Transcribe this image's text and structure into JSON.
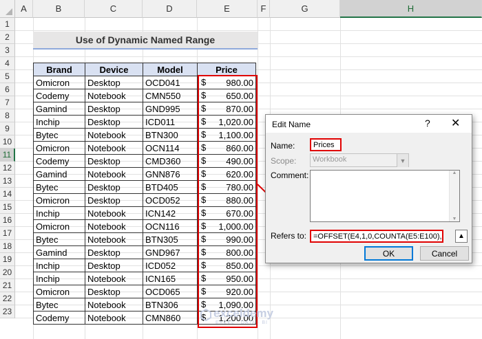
{
  "sheet": {
    "columns": [
      "A",
      "B",
      "C",
      "D",
      "E",
      "F",
      "G",
      "H"
    ],
    "selected_column": "H",
    "rows": [
      "1",
      "2",
      "3",
      "4",
      "5",
      "6",
      "7",
      "8",
      "9",
      "10",
      "11",
      "12",
      "13",
      "14",
      "15",
      "16",
      "17",
      "18",
      "19",
      "20",
      "21",
      "22",
      "23"
    ],
    "selected_row": "11"
  },
  "title": "Use of Dynamic Named Range",
  "table": {
    "headers": [
      "Brand",
      "Device",
      "Model",
      "Price"
    ],
    "currency_symbol": "$",
    "rows": [
      [
        "Omicron",
        "Desktop",
        "OCD041",
        "980.00"
      ],
      [
        "Codemy",
        "Notebook",
        "CMN550",
        "650.00"
      ],
      [
        "Gamind",
        "Desktop",
        "GND995",
        "870.00"
      ],
      [
        "Inchip",
        "Desktop",
        "ICD011",
        "1,020.00"
      ],
      [
        "Bytec",
        "Notebook",
        "BTN300",
        "1,100.00"
      ],
      [
        "Omicron",
        "Notebook",
        "OCN114",
        "860.00"
      ],
      [
        "Codemy",
        "Desktop",
        "CMD360",
        "490.00"
      ],
      [
        "Gamind",
        "Notebook",
        "GNN876",
        "620.00"
      ],
      [
        "Bytec",
        "Desktop",
        "BTD405",
        "780.00"
      ],
      [
        "Omicron",
        "Desktop",
        "OCD052",
        "880.00"
      ],
      [
        "Inchip",
        "Notebook",
        "ICN142",
        "670.00"
      ],
      [
        "Omicron",
        "Notebook",
        "OCN116",
        "1,000.00"
      ],
      [
        "Bytec",
        "Notebook",
        "BTN305",
        "990.00"
      ],
      [
        "Gamind",
        "Desktop",
        "GND967",
        "800.00"
      ],
      [
        "Inchip",
        "Desktop",
        "ICD052",
        "850.00"
      ],
      [
        "Inchip",
        "Notebook",
        "ICN165",
        "950.00"
      ],
      [
        "Omicron",
        "Desktop",
        "OCD065",
        "920.00"
      ],
      [
        "Bytec",
        "Notebook",
        "BTN306",
        "1,090.00"
      ],
      [
        "Codemy",
        "Notebook",
        "CMN860",
        "1,200.00"
      ]
    ]
  },
  "dialog": {
    "title": "Edit Name",
    "help": "?",
    "close": "✕",
    "name_label": "Name:",
    "name_value": "Prices",
    "scope_label": "Scope:",
    "scope_value": "Workbook",
    "comment_label": "Comment:",
    "refers_label": "Refers to:",
    "refers_value": "=OFFSET(E4,1,0,COUNTA(E5:E100),1)",
    "ok": "OK",
    "cancel": "Cancel"
  },
  "watermark": {
    "text": "exceldemy",
    "sub": "EXCEL · DATA · BI"
  },
  "colors": {
    "highlight_red": "#e00000",
    "header_fill": "#d9e1f2",
    "title_fill": "#e7e6e6",
    "excel_green": "#217346"
  }
}
